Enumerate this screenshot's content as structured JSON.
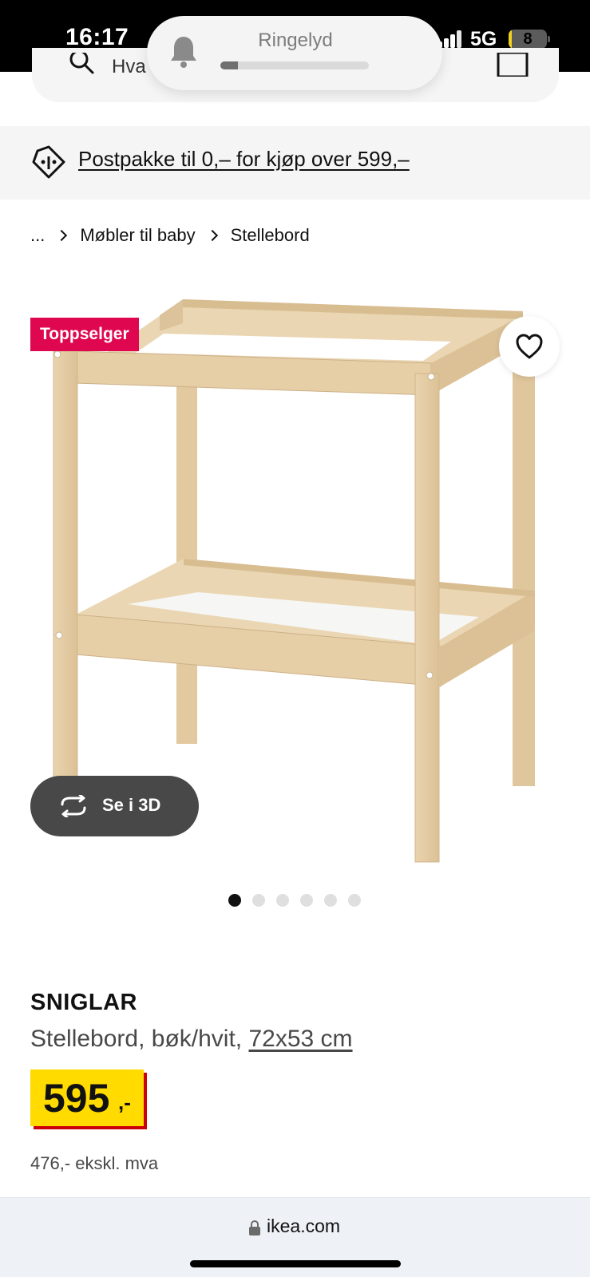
{
  "status_bar": {
    "time": "16:17",
    "network": "5G",
    "battery": "8",
    "battery_level": 0.08
  },
  "ringer": {
    "label": "Ringelyd",
    "volume_level": 0.12
  },
  "search": {
    "placeholder": "Hva"
  },
  "promo": {
    "text": "Postpakke til 0,– for kjøp over 599,–"
  },
  "breadcrumb": {
    "ellipsis": "...",
    "items": [
      "Møbler til baby",
      "Stellebord"
    ]
  },
  "image": {
    "badge": "Toppselger",
    "view_3d_label": "Se i 3D",
    "dots": 6,
    "active_dot": 1
  },
  "product": {
    "name": "SNIGLAR",
    "description": "Stellebord, bøk/hvit, ",
    "size": "72x53 cm",
    "price": "595",
    "price_suffix": ",-",
    "price_excl_vat": "476,- ekskl. mva",
    "price_box_color": "#ffdb00",
    "price_shadow_color": "#cc0008"
  },
  "browser": {
    "url": "ikea.com"
  },
  "colors": {
    "badge": "#e00751",
    "view_3d_button": "#484848"
  }
}
